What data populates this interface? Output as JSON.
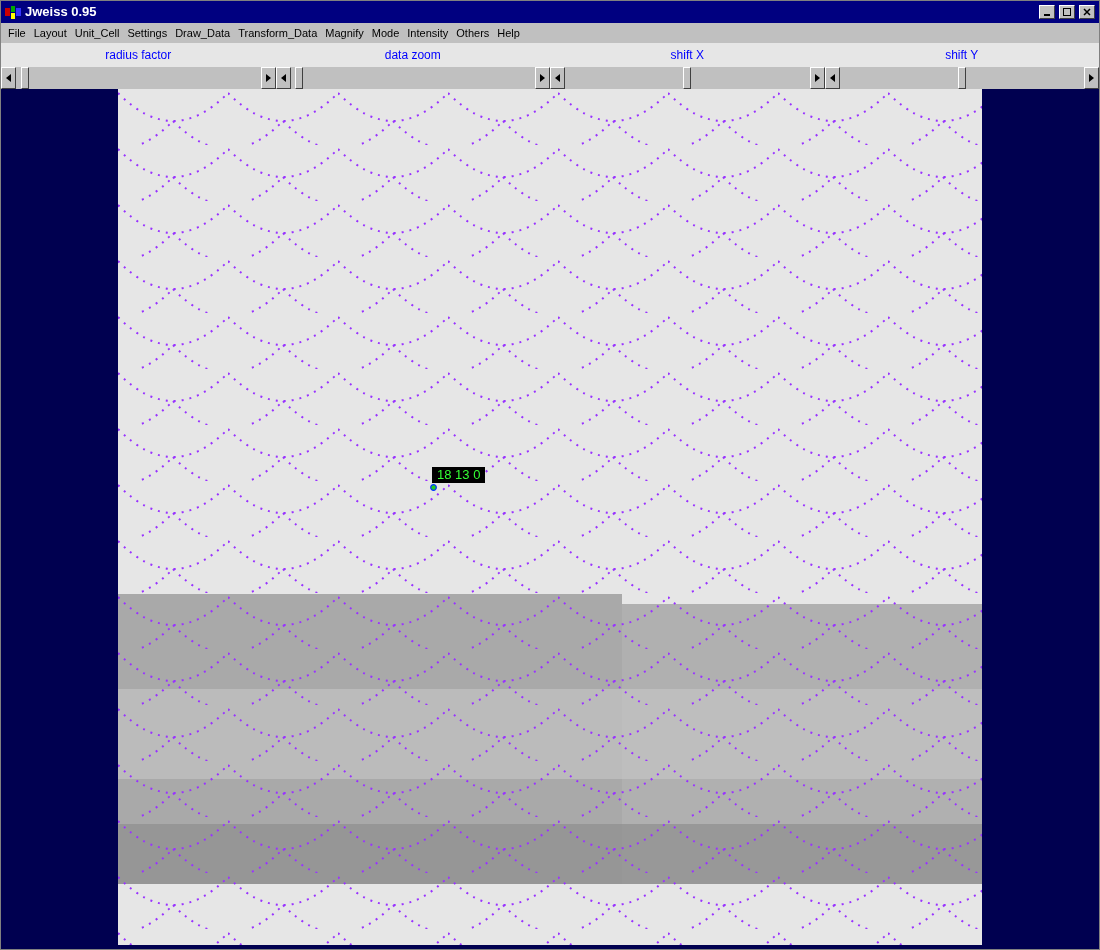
{
  "window": {
    "title": "Jweiss 0.95"
  },
  "menu": [
    "File",
    "Layout",
    "Unit_Cell",
    "Settings",
    "Draw_Data",
    "Transform_Data",
    "Magnify",
    "Mode",
    "Intensity",
    "Others",
    "Help"
  ],
  "sliders": [
    {
      "label": "radius factor",
      "level": 0.02
    },
    {
      "label": "data zoom",
      "level": 0.02
    },
    {
      "label": "shift X",
      "level": 0.5
    },
    {
      "label": "shift Y",
      "level": 0.5
    }
  ],
  "image": {
    "hkl_label": "18 13 0"
  }
}
